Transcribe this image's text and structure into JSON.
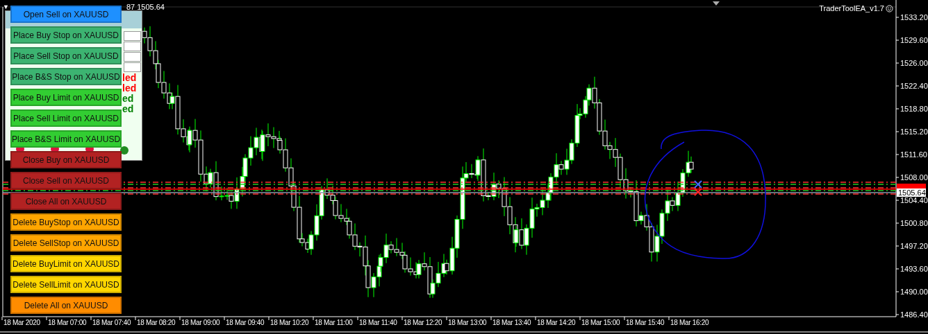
{
  "chart_header": {
    "arrow": "▼",
    "quote": "87 1505.64"
  },
  "ea_label": {
    "text": "TraderToolEA_v1.7"
  },
  "price_axis": [
    "1533.20",
    "1529.60",
    "1526.00",
    "1522.40",
    "1518.80",
    "1515.20",
    "1511.60",
    "1508.00",
    "1504.40",
    "1500.80",
    "1497.20",
    "1493.60",
    "1490.00",
    "1486.40"
  ],
  "current_price": "1505.64",
  "time_axis": [
    "18 Mar 2020",
    "18 Mar 07:00",
    "18 Mar 07:40",
    "18 Mar 08:20",
    "18 Mar 09:00",
    "18 Mar 09:40",
    "18 Mar 10:20",
    "18 Mar 11:00",
    "18 Mar 11:40",
    "18 Mar 12:20",
    "18 Mar 13:00",
    "18 Mar 13:40",
    "18 Mar 14:20",
    "18 Mar 15:00",
    "18 Mar 15:40",
    "18 Mar 16:20"
  ],
  "panel": {
    "status_fragments": [
      {
        "text": "led",
        "color": "#ff0000"
      },
      {
        "text": "led",
        "color": "#ff0000"
      },
      {
        "text": "ed",
        "color": "#008000"
      },
      {
        "text": "ed",
        "color": "#008000"
      }
    ],
    "dots": [
      {
        "color": "#dc143c"
      },
      {
        "color": "#dc143c"
      },
      {
        "color": "#dc143c"
      },
      {
        "color": "#228b22"
      }
    ]
  },
  "buttons": [
    {
      "label": "Open Sell on XAUUSD",
      "color": "#1e90ff"
    },
    {
      "label": "Place Buy Stop on XAUUSD",
      "color": "#3cb371"
    },
    {
      "label": "Place Sell Stop on XAUUSD",
      "color": "#3cb371"
    },
    {
      "label": "Place B&S Stop on XAUUSD",
      "color": "#3cb371"
    },
    {
      "label": "Place Buy Limit on XAUUSD",
      "color": "#32cd32"
    },
    {
      "label": "Place Sell Limit on XAUUSD",
      "color": "#32cd32"
    },
    {
      "label": "Place B&S Limit on XAUUSD",
      "color": "#32cd32"
    },
    {
      "label": "Close Buy on XAUUSD",
      "color": "#b22222"
    },
    {
      "label": "Close Sell on XAUUSD",
      "color": "#b22222"
    },
    {
      "label": "Close All on XAUUSD",
      "color": "#b22222"
    },
    {
      "label": "Delete BuyStop on XAUUSD",
      "color": "#ffa500"
    },
    {
      "label": "Delete SellStop on XAUUSD",
      "color": "#ffa500"
    },
    {
      "label": "Delete BuyLimit on XAUUSD",
      "color": "#ffd700"
    },
    {
      "label": "Delete SellLimit on XAUUSD",
      "color": "#ffd700"
    },
    {
      "label": "Delete All on XAUUSD",
      "color": "#ff8c00"
    }
  ]
}
